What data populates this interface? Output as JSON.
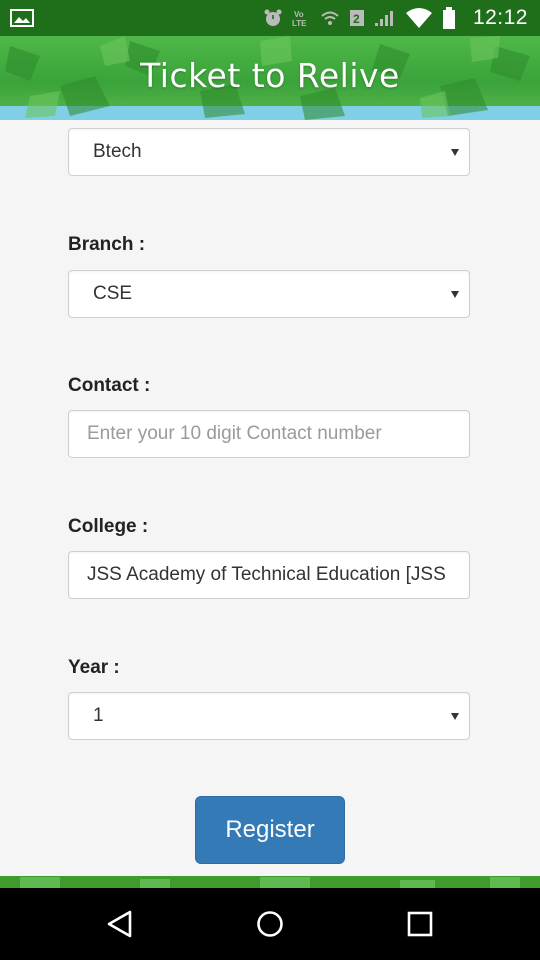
{
  "status_bar": {
    "time": "12:12",
    "icons": [
      "gallery-icon",
      "alarm-icon",
      "volte-icon",
      "wifi-icon",
      "sim-2-icon",
      "signal-icon",
      "wifi-full-icon",
      "battery-icon"
    ]
  },
  "header": {
    "title": "Ticket to Relive"
  },
  "form": {
    "course": {
      "value": "Btech"
    },
    "branch": {
      "label": "Branch :",
      "value": "CSE"
    },
    "contact": {
      "label": "Contact :",
      "placeholder": "Enter your 10 digit Contact number",
      "value": ""
    },
    "college": {
      "label": "College :",
      "value": "JSS Academy of Technical Education [JSS"
    },
    "year": {
      "label": "Year :",
      "value": "1"
    },
    "register_label": "Register"
  },
  "navigation": {
    "back": "back-icon",
    "home": "home-icon",
    "recents": "recents-icon"
  },
  "colors": {
    "status_bar": "#1f6f1a",
    "header": "#3aa33a",
    "button": "#337ab7",
    "background": "#f5f5f5"
  }
}
